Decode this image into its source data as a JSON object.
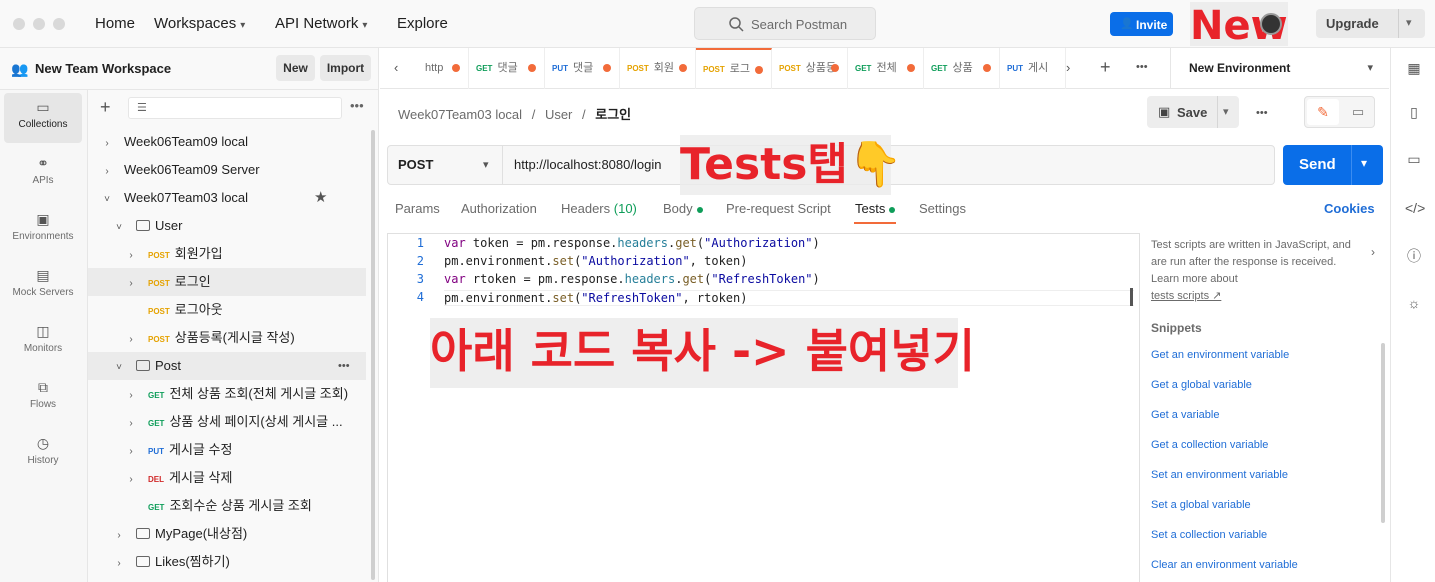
{
  "topbar": {
    "nav": [
      "Home",
      "Workspaces",
      "API Network",
      "Explore"
    ],
    "search_placeholder": "Search Postman",
    "invite_label": "Invite",
    "upgrade_label": "Upgrade"
  },
  "annotations": {
    "new": "New",
    "tests_tab": "Tests탭👇",
    "copy_paste": "아래 코드 복사 -> 붙여넣기"
  },
  "workspace": {
    "name": "New Team Workspace",
    "new_label": "New",
    "import_label": "Import"
  },
  "rail": {
    "items": [
      "Collections",
      "APIs",
      "Environments",
      "Mock Servers",
      "Monitors",
      "Flows",
      "History"
    ]
  },
  "tree": {
    "rows": [
      {
        "label": "Week06Team09 local",
        "method": ""
      },
      {
        "label": "Week06Team09 Server",
        "method": ""
      },
      {
        "label": "Week07Team03 local",
        "method": ""
      },
      {
        "label": "User",
        "method": ""
      },
      {
        "label": "회원가입",
        "method": "POST"
      },
      {
        "label": "로그인",
        "method": "POST"
      },
      {
        "label": "로그아웃",
        "method": "POST"
      },
      {
        "label": "상품등록(게시글 작성)",
        "method": "POST"
      },
      {
        "label": "Post",
        "method": ""
      },
      {
        "label": "전체 상품 조회(전체 게시글 조회)",
        "method": "GET"
      },
      {
        "label": "상품 상세 페이지(상세 게시글 ...",
        "method": "GET"
      },
      {
        "label": "게시글 수정",
        "method": "PUT"
      },
      {
        "label": "게시글 삭제",
        "method": "DEL"
      },
      {
        "label": "조회수순 상품 게시글 조회",
        "method": "GET"
      },
      {
        "label": "MyPage(내상점)",
        "method": ""
      },
      {
        "label": "Likes(찜하기)",
        "method": ""
      }
    ]
  },
  "tabs": [
    {
      "method": "",
      "label": "http"
    },
    {
      "method": "GET",
      "label": "댓글"
    },
    {
      "method": "PUT",
      "label": "댓글"
    },
    {
      "method": "POST",
      "label": "회원"
    },
    {
      "method": "POST",
      "label": "로그"
    },
    {
      "method": "POST",
      "label": "상품등"
    },
    {
      "method": "GET",
      "label": "전체"
    },
    {
      "method": "GET",
      "label": "상품"
    },
    {
      "method": "PUT",
      "label": "게시"
    }
  ],
  "environment": "New Environment",
  "breadcrumb": {
    "a": "Week07Team03 local",
    "sep": "/",
    "b": "User",
    "c": "로그인"
  },
  "save_label": "Save",
  "request": {
    "method": "POST",
    "url": "http://localhost:8080/login",
    "send_label": "Send"
  },
  "reqtabs": {
    "params": "Params",
    "authorization": "Authorization",
    "headers": "Headers",
    "headers_count": "(10)",
    "body": "Body",
    "prerequest": "Pre-request Script",
    "tests": "Tests",
    "settings": "Settings",
    "cookies": "Cookies"
  },
  "code": {
    "line_numbers": [
      "1",
      "2",
      "3",
      "4"
    ]
  },
  "sidepanel": {
    "info": "Test scripts are written in JavaScript, and are run after the response is received. Learn more about",
    "link": "tests scripts ↗",
    "snippets_title": "Snippets",
    "snippets": [
      "Get an environment variable",
      "Get a global variable",
      "Get a variable",
      "Get a collection variable",
      "Set an environment variable",
      "Set a global variable",
      "Set a collection variable",
      "Clear an environment variable"
    ]
  }
}
